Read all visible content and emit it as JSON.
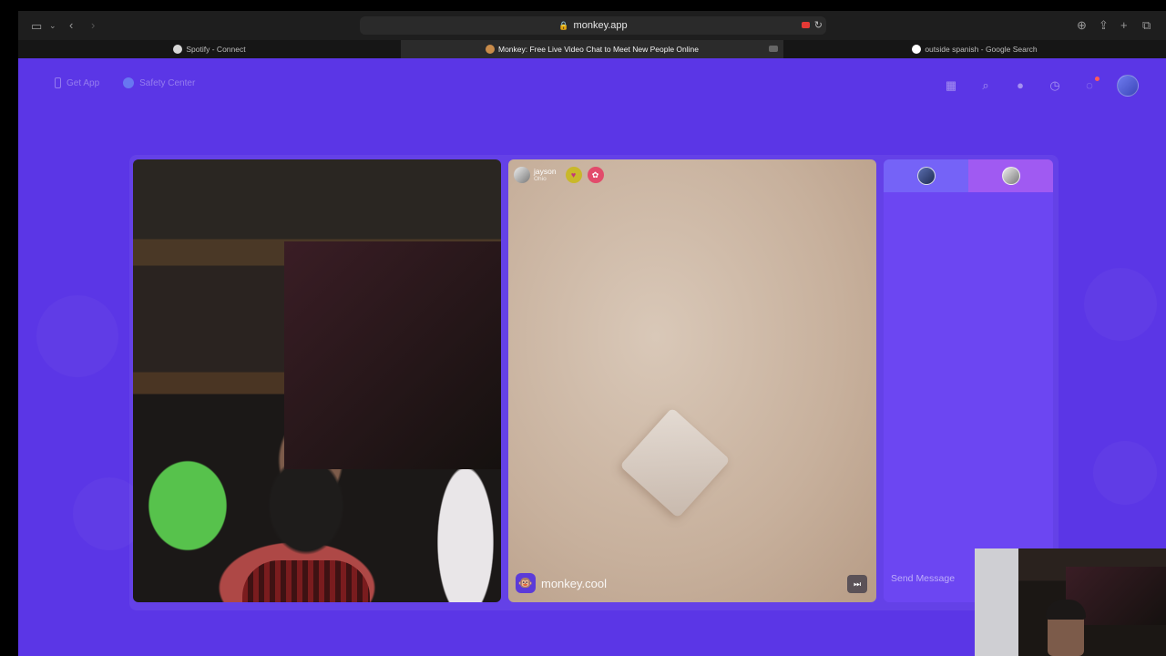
{
  "browser": {
    "address": "monkey.app",
    "tabs": [
      {
        "title": "Spotify - Connect",
        "active": false,
        "favicon_color": "#d8d8d8"
      },
      {
        "title": "Monkey: Free Live Video Chat to Meet New People Online",
        "active": true,
        "favicon_color": "#c88b4a"
      },
      {
        "title": "outside spanish - Google Search",
        "active": false,
        "favicon_color": "#ffffff"
      }
    ],
    "icons": [
      "sidebar-icon",
      "back-icon",
      "forward-icon",
      "lock-icon",
      "camera-recording-icon",
      "reload-icon",
      "download-icon",
      "share-icon",
      "new-tab-icon",
      "tabs-overview-icon"
    ]
  },
  "nav": {
    "get_app": "Get App",
    "safety_center": "Safety Center",
    "right_icons": [
      "store-icon",
      "search-icon",
      "coin-icon",
      "history-icon",
      "messages-icon",
      "profile-avatar"
    ]
  },
  "peer": {
    "name": "jayson",
    "location": "Ohio"
  },
  "watermark": "monkey.cool",
  "chat": {
    "placeholder": "Send Message"
  },
  "colors": {
    "page_bg": "#5b36e6",
    "chat_bg": "#6c46f2",
    "chat_tab_left": "#7563f7",
    "chat_tab_right": "#a05af2"
  }
}
